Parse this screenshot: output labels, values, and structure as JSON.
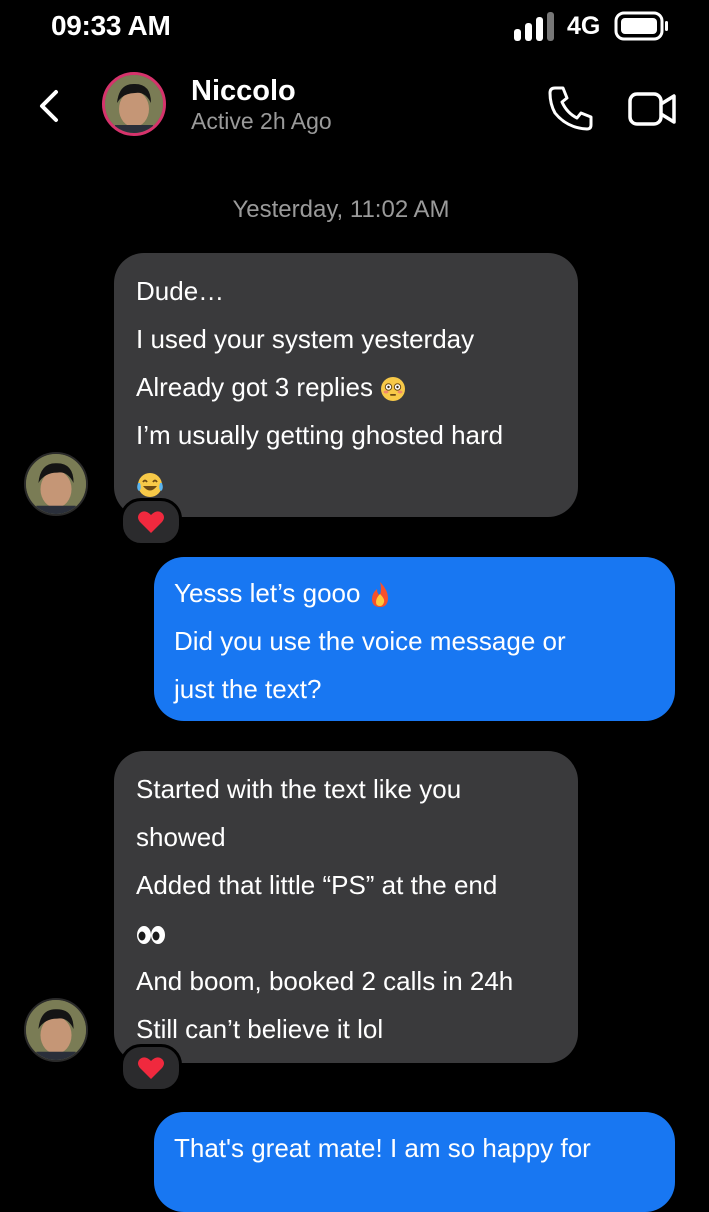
{
  "status_bar": {
    "time": "09:33 AM",
    "network": "4G"
  },
  "header": {
    "name": "Niccolo",
    "activity": "Active 2h Ago"
  },
  "timestamp": "Yesterday, 11:02 AM",
  "messages": [
    {
      "direction": "incoming",
      "lines": [
        "Dude…",
        "I used your system yesterday",
        "Already got 3 replies",
        "I’m usually getting ghosted hard",
        ""
      ],
      "emojis": [
        "flushed-face",
        "crying-laughing-face"
      ],
      "reaction": "red-heart"
    },
    {
      "direction": "outgoing",
      "lines": [
        "Yesss let’s gooo",
        "Did you use the voice message or",
        "just the text?"
      ],
      "emojis": [
        "fire"
      ]
    },
    {
      "direction": "incoming",
      "lines": [
        "Started with the text like you",
        "showed",
        "Added that little “PS” at the end",
        "",
        "And boom, booked 2 calls in 24h",
        "Still can’t believe it lol"
      ],
      "emojis": [
        "eyes"
      ],
      "reaction": "red-heart"
    },
    {
      "direction": "outgoing",
      "lines": [
        "That's great mate! I am so happy for"
      ]
    }
  ],
  "colors": {
    "background": "#000000",
    "incoming_bubble": "#3a3a3c",
    "outgoing_bubble": "#1877f2",
    "avatar_ring": "#d6336c",
    "muted_text": "#9a9a9a"
  }
}
